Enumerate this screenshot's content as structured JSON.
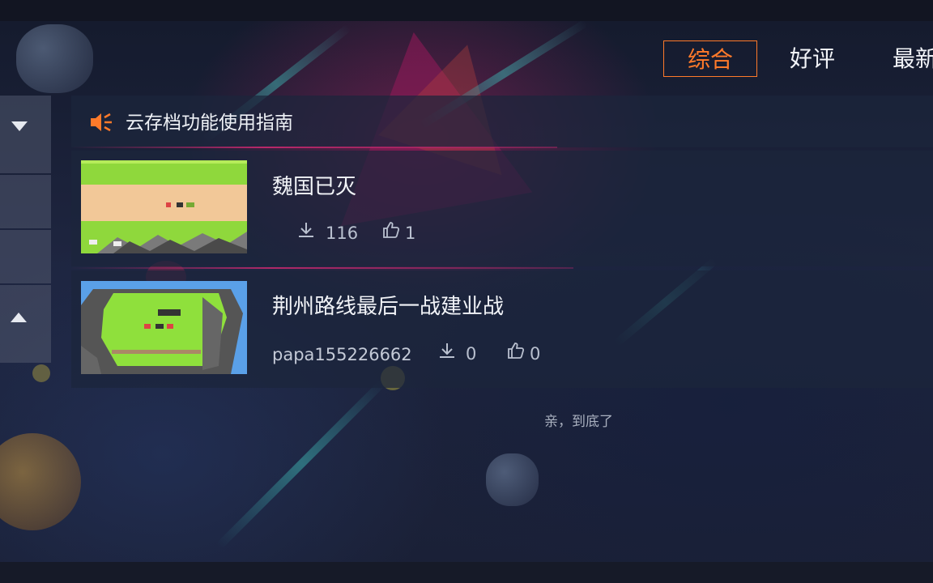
{
  "tabs": [
    {
      "label": "综合",
      "active": true
    },
    {
      "label": "好评",
      "active": false
    },
    {
      "label": "最新",
      "active": false
    }
  ],
  "notice": {
    "text": "云存档功能使用指南",
    "icon": "speaker-icon"
  },
  "side_nav": {
    "up_icon": "chevron-up-icon",
    "down_icon": "chevron-down-icon"
  },
  "items": [
    {
      "title": "魏国已灭",
      "author": "",
      "downloads": "116",
      "likes": "1"
    },
    {
      "title": "荆州路线最后一战建业战",
      "author": "papa155226662",
      "downloads": "0",
      "likes": "0"
    }
  ],
  "footer_text": "亲，到底了",
  "colors": {
    "accent": "#ff7a2a",
    "panel": "#1c263c",
    "divider": "#c8286e"
  }
}
